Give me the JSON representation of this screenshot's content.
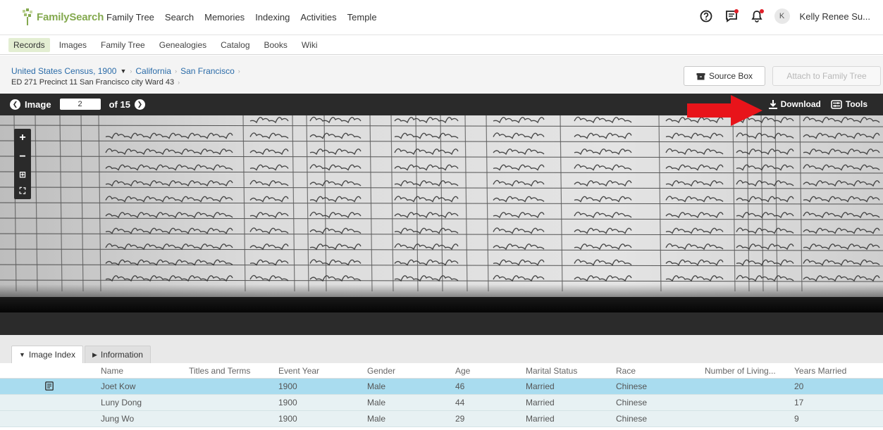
{
  "header": {
    "logo_text": "FamilySearch",
    "nav": [
      "Family Tree",
      "Search",
      "Memories",
      "Indexing",
      "Activities",
      "Temple"
    ],
    "avatar_initial": "K",
    "username": "Kelly Renee Su...",
    "icons": [
      "help-icon",
      "messages-icon",
      "notifications-icon"
    ]
  },
  "subnav": {
    "items": [
      "Records",
      "Images",
      "Family Tree",
      "Genealogies",
      "Catalog",
      "Books",
      "Wiki"
    ],
    "active": "Records"
  },
  "breadcrumb": {
    "collection": "United States Census, 1900",
    "state": "California",
    "city": "San Francisco",
    "district": "ED 271 Precinct 11 San Francisco city Ward 43"
  },
  "actions": {
    "source_box": "Source Box",
    "attach": "Attach to Family Tree"
  },
  "viewer": {
    "image_label": "Image",
    "current_page": "2",
    "of_label": "of 15",
    "download": "Download",
    "tools": "Tools"
  },
  "panel": {
    "tabs": [
      "Image Index",
      "Information"
    ],
    "columns": [
      "Name",
      "Titles and Terms",
      "Event Year",
      "Gender",
      "Age",
      "Marital Status",
      "Race",
      "Number of Living...",
      "Years Married"
    ],
    "rows": [
      {
        "name": "Joet Kow",
        "titles": "",
        "year": "1900",
        "gender": "Male",
        "age": "46",
        "marital": "Married",
        "race": "Chinese",
        "living": "",
        "years_married": "20"
      },
      {
        "name": "Luny Dong",
        "titles": "",
        "year": "1900",
        "gender": "Male",
        "age": "44",
        "marital": "Married",
        "race": "Chinese",
        "living": "",
        "years_married": "17"
      },
      {
        "name": "Jung Wo",
        "titles": "",
        "year": "1900",
        "gender": "Male",
        "age": "29",
        "marital": "Married",
        "race": "Chinese",
        "living": "",
        "years_married": "9"
      }
    ]
  },
  "colors": {
    "brand_green": "#84a94f",
    "link_blue": "#2a6ba8",
    "selected_row": "#a9dcef",
    "annotation_arrow": "#e8141a"
  }
}
